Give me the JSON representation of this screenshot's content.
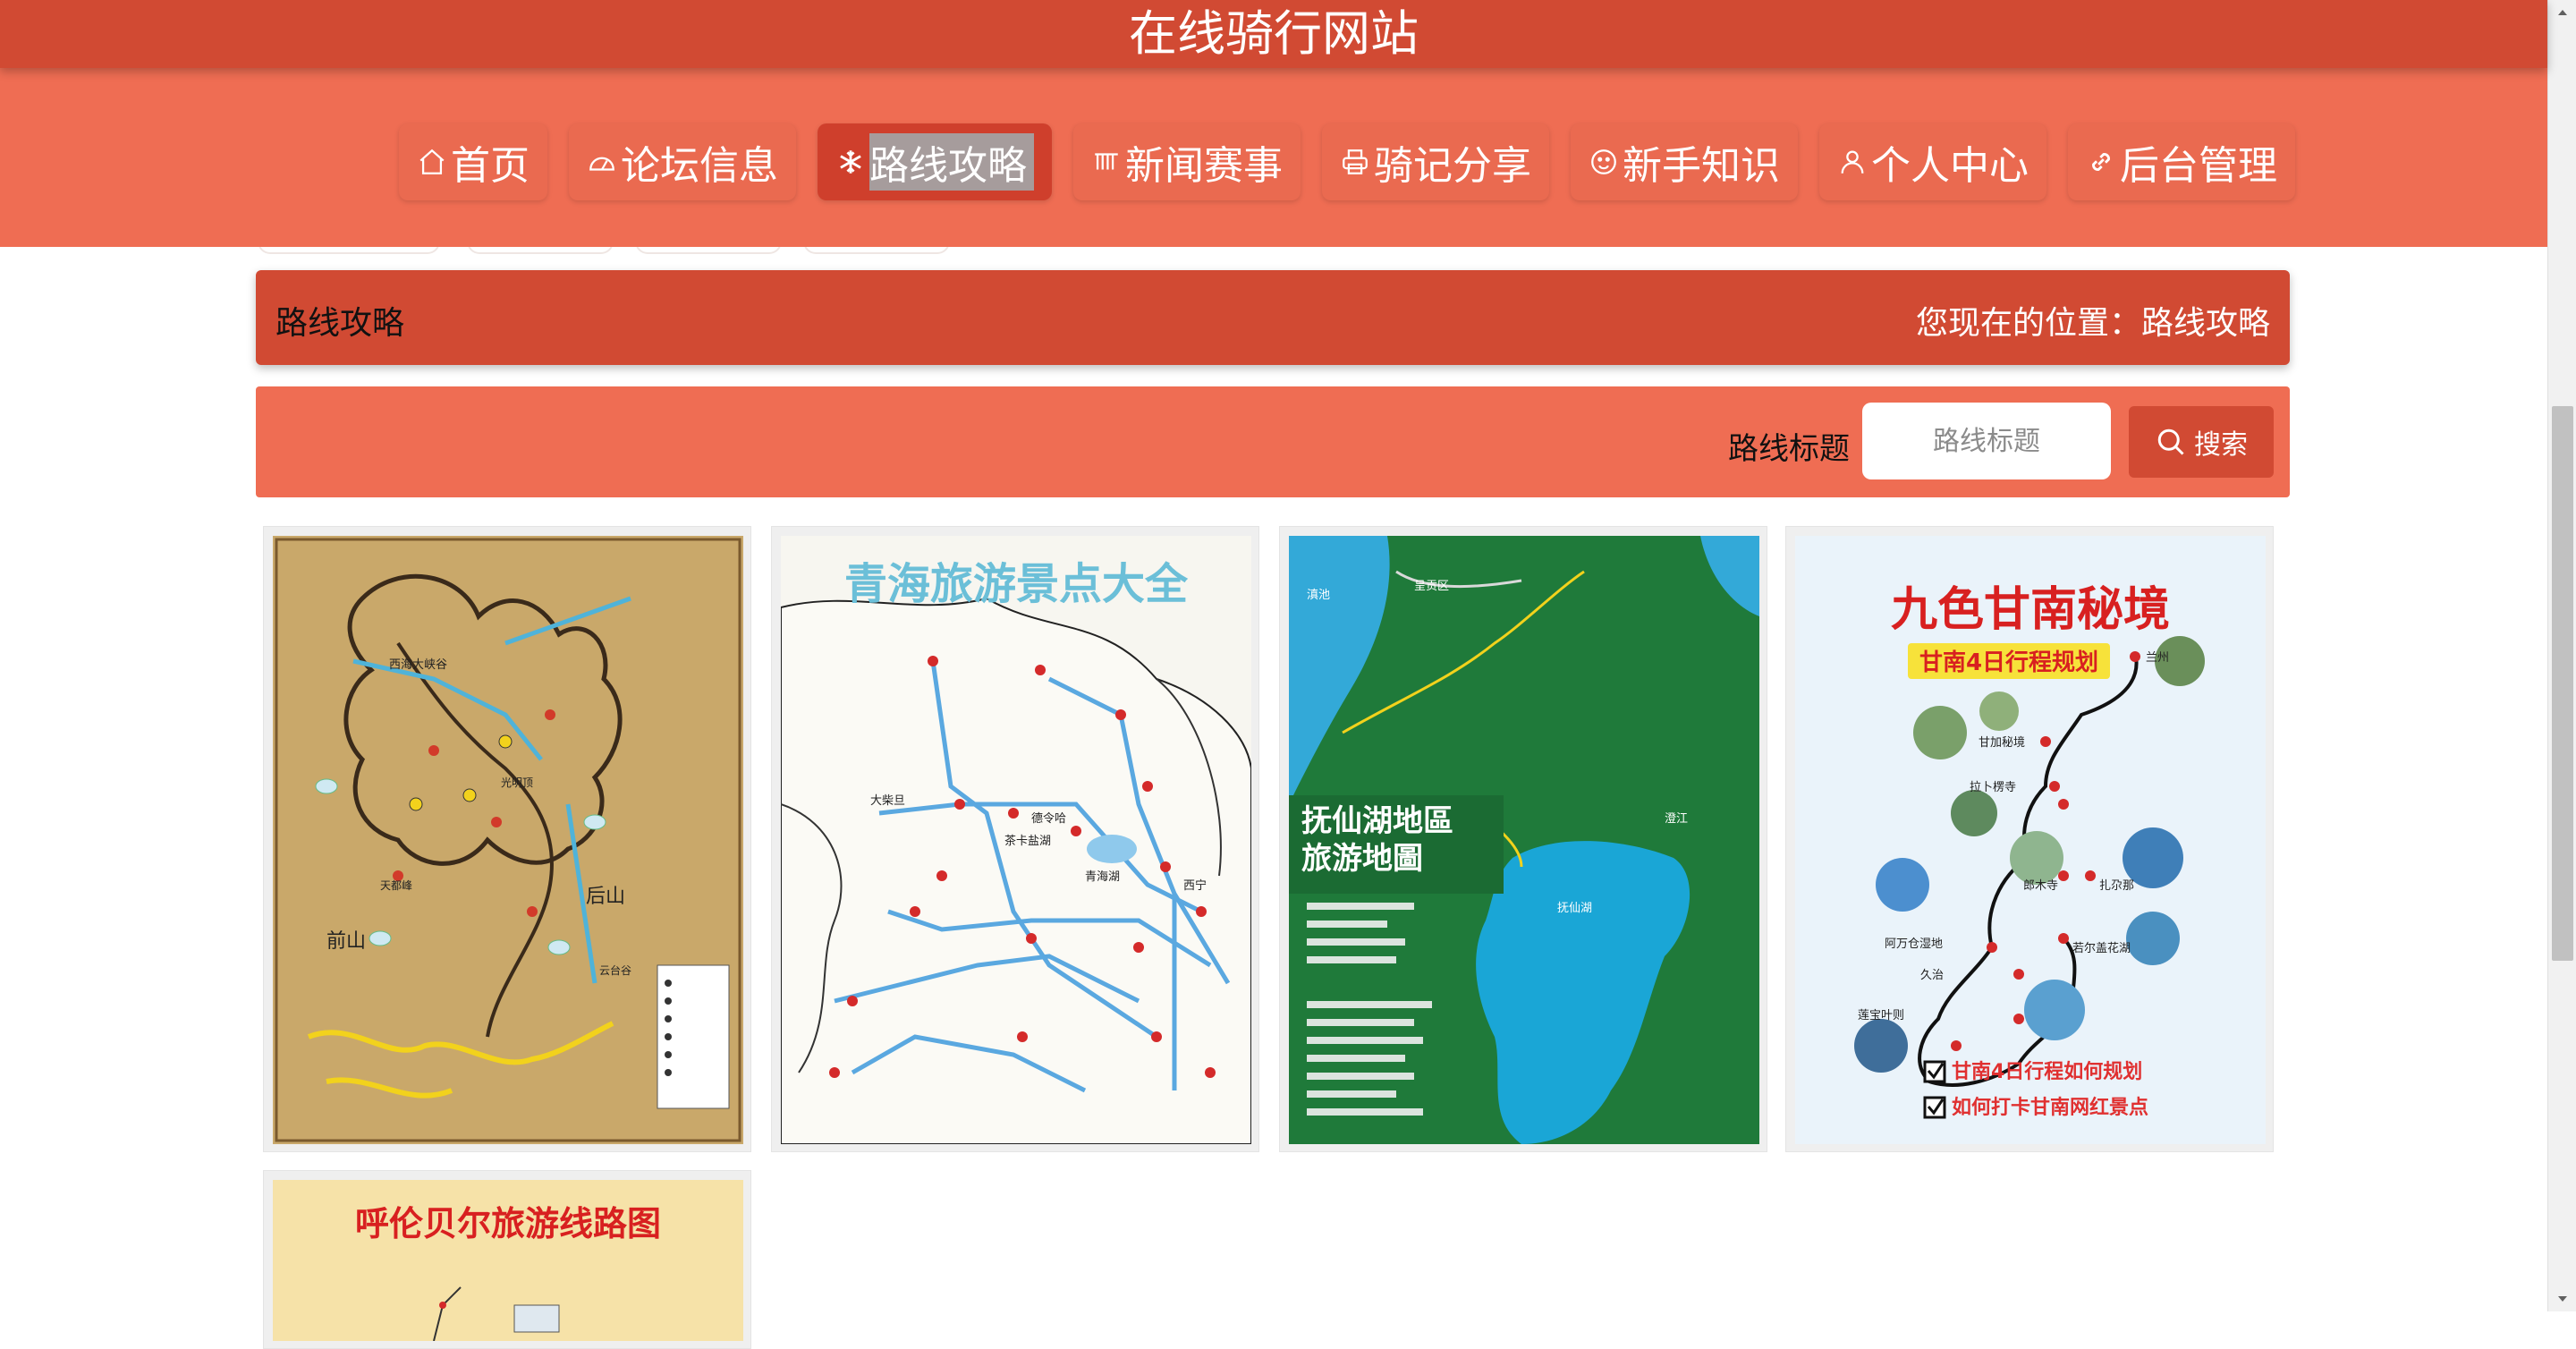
{
  "header": {
    "site_title": "在线骑行网站"
  },
  "nav": {
    "items": [
      {
        "label": "首页",
        "icon": "home-icon"
      },
      {
        "label": "论坛信息",
        "icon": "gauge-icon"
      },
      {
        "label": "路线攻略",
        "icon": "snowflake-icon",
        "active": true
      },
      {
        "label": "新闻赛事",
        "icon": "grid-icon"
      },
      {
        "label": "骑记分享",
        "icon": "printer-icon"
      },
      {
        "label": "新手知识",
        "icon": "smile-icon"
      },
      {
        "label": "个人中心",
        "icon": "user-icon"
      },
      {
        "label": "后台管理",
        "icon": "link-icon"
      }
    ]
  },
  "page": {
    "title": "路线攻略",
    "breadcrumb": "您现在的位置：路线攻略"
  },
  "search": {
    "label": "路线标题",
    "placeholder": "路线标题",
    "value": "",
    "button_label": "搜索"
  },
  "routes": [
    {
      "title": "",
      "map_text": [
        "西海大峡谷",
        "前山",
        "后山",
        "云台谷",
        "光明顶",
        "天都峰"
      ]
    },
    {
      "title": "青海旅游景点大全",
      "map_text": [
        "大柴旦",
        "德令哈",
        "青海湖",
        "西宁",
        "茶卡盐湖"
      ]
    },
    {
      "title": "抚仙湖地區旅游地圖",
      "map_text": [
        "澄江",
        "抚仙湖",
        "滇池",
        "呈贡区"
      ]
    },
    {
      "title": "九色甘南秘境",
      "subtitle": "甘南4日行程规划",
      "notes": [
        "甘南4日行程如何规划",
        "如何打卡甘南网红景点"
      ],
      "map_text": [
        "兰州",
        "甘加秘境",
        "拉卜楞寺",
        "郎木寺",
        "扎尕那",
        "若尔盖花湖",
        "久治",
        "莲宝叶则",
        "阿万仓湿地"
      ]
    },
    {
      "title": "呼伦贝尔旅游线路图",
      "map_text": []
    }
  ],
  "colors": {
    "header_red": "#d14a33",
    "nav_orange": "#ef6d53",
    "active_nav": "#cf3f2c"
  }
}
